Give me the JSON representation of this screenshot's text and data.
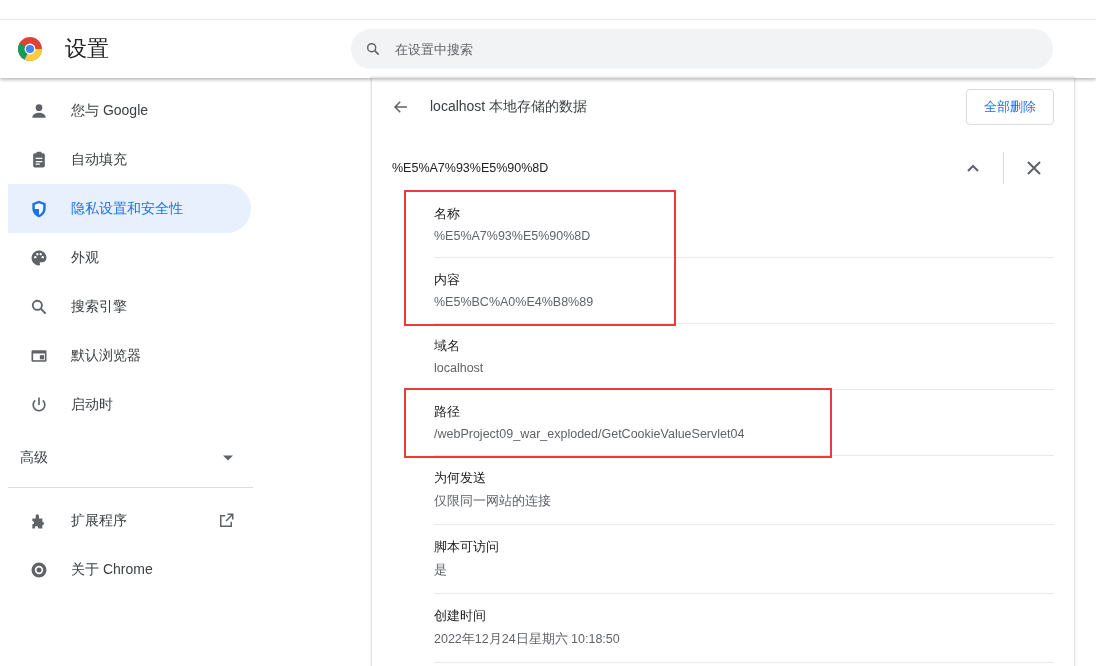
{
  "header": {
    "title": "设置",
    "search": {
      "placeholder": "在设置中搜索"
    }
  },
  "sidebar": {
    "items": [
      {
        "kind": "link",
        "label": "您与 Google",
        "selected": false
      },
      {
        "kind": "link",
        "label": "自动填充",
        "selected": false
      },
      {
        "kind": "link",
        "label": "隐私设置和安全性",
        "selected": true
      },
      {
        "kind": "link",
        "label": "外观",
        "selected": false
      },
      {
        "kind": "link",
        "label": "搜索引擎",
        "selected": false
      },
      {
        "kind": "link",
        "label": "默认浏览器",
        "selected": false
      },
      {
        "kind": "link",
        "label": "启动时",
        "selected": false
      },
      {
        "kind": "expander",
        "label": "高级",
        "expanded": false
      },
      {
        "kind": "external",
        "label": "扩展程序",
        "selected": false
      },
      {
        "kind": "link",
        "label": "关于 Chrome",
        "selected": false
      }
    ]
  },
  "page": {
    "title": "localhost 本地存储的数据",
    "delete_all_button": "全部删除",
    "cookie": {
      "name": "%E5%A7%93%E5%90%8D",
      "expanded": true,
      "groups": [
        {
          "annotated": true,
          "fields": [
            {
              "label": "名称",
              "value": "%E5%A7%93%E5%90%8D"
            },
            {
              "label": "内容",
              "value": "%E5%BC%A0%E4%B8%89"
            }
          ]
        },
        {
          "annotated": false,
          "fields": [
            {
              "label": "域名",
              "value": "localhost"
            }
          ]
        },
        {
          "annotated": true,
          "fields": [
            {
              "label": "路径",
              "value": "/webProject09_war_exploded/GetCookieValueServlet04"
            }
          ]
        },
        {
          "annotated": false,
          "fields": [
            {
              "label": "为何发送",
              "value": "仅限同一网站的连接"
            }
          ]
        },
        {
          "annotated": false,
          "fields": [
            {
              "label": "脚本可访问",
              "value": "是"
            }
          ]
        },
        {
          "annotated": false,
          "fields": [
            {
              "label": "创建时间",
              "value": "2022年12月24日星期六 10:18:50"
            }
          ]
        }
      ]
    }
  }
}
